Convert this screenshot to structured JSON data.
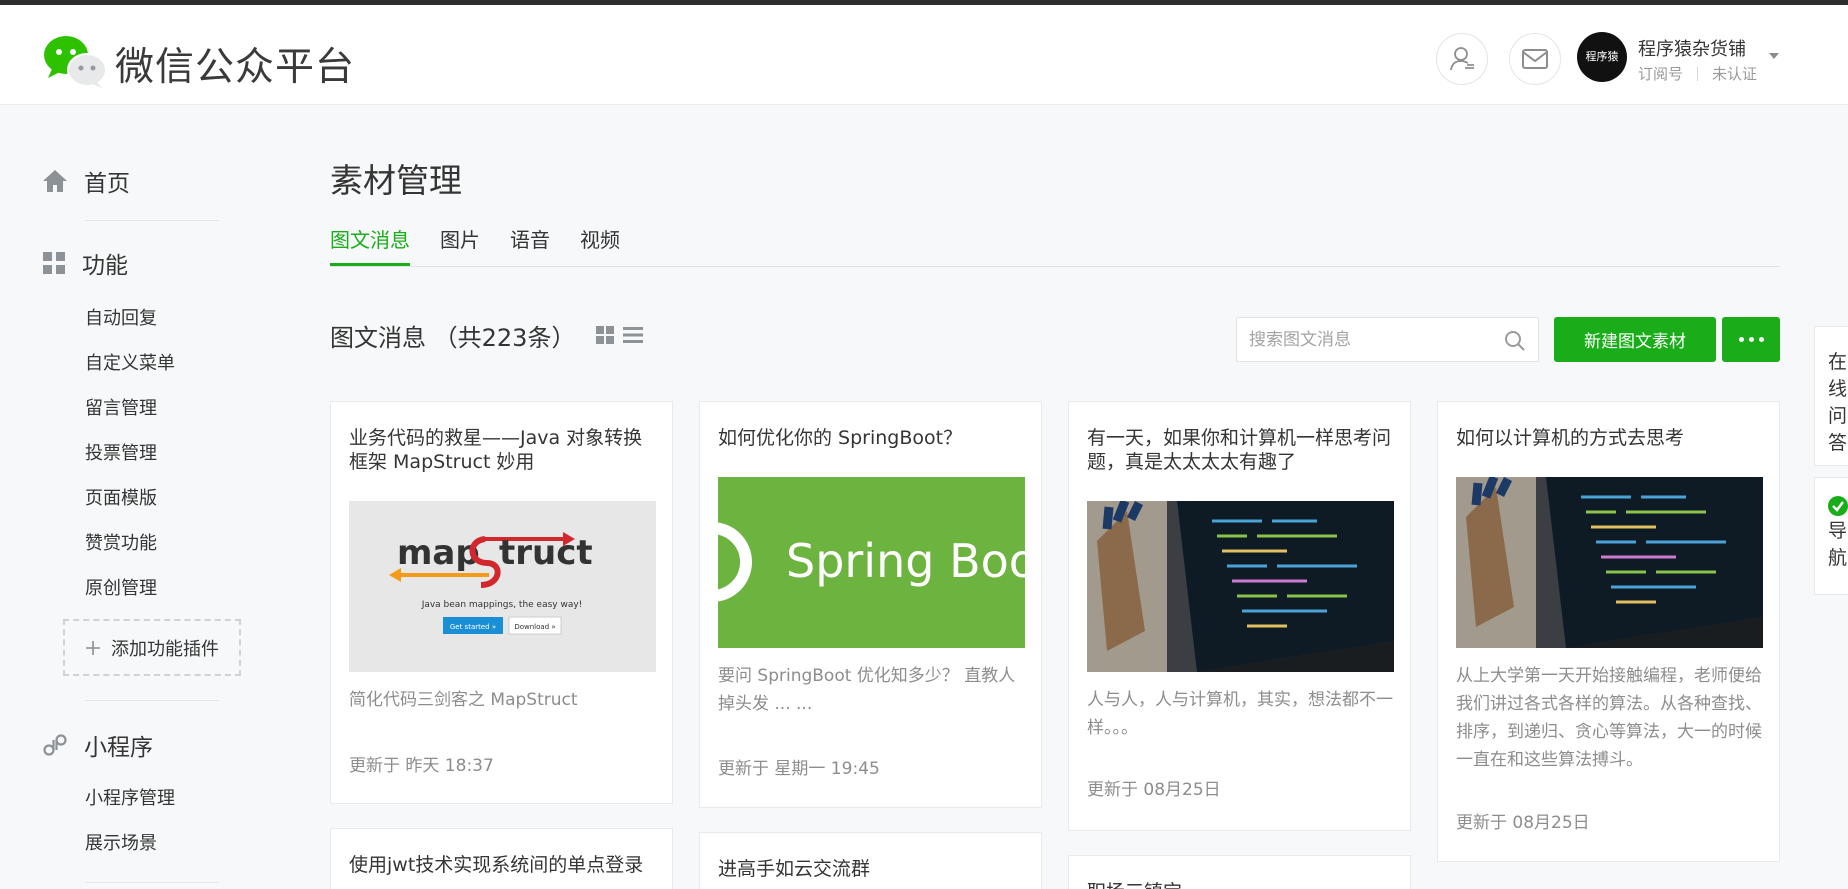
{
  "header": {
    "brand": "微信公众平台",
    "account": {
      "name": "程序猿杂货铺",
      "type": "订阅号",
      "verify": "未认证",
      "avatar_text": "程序猿"
    }
  },
  "sidebar": {
    "home": "首页",
    "features": "功能",
    "feature_items": [
      "自动回复",
      "自定义菜单",
      "留言管理",
      "投票管理",
      "页面模版",
      "赞赏功能",
      "原创管理"
    ],
    "add_plugin": "添加功能插件",
    "miniprogram": "小程序",
    "mini_items": [
      "小程序管理",
      "展示场景"
    ]
  },
  "main": {
    "title": "素材管理",
    "tabs": [
      "图文消息",
      "图片",
      "语音",
      "视频"
    ],
    "active_tab": "图文消息",
    "list_title": "图文消息",
    "list_count": "（共223条）",
    "search_placeholder": "搜索图文消息",
    "new_button": "新建图文素材"
  },
  "cards": [
    {
      "title": "业务代码的救星——Java 对象转换框架 MapStruct 妙用",
      "thumb": "mapstruct",
      "thumb_logo_a": "map",
      "thumb_logo_b": "truct",
      "thumb_tagline": "Java bean mappings, the easy way!",
      "thumb_btn1": "Get started »",
      "thumb_btn2": "Download »",
      "desc": "简化代码三剑客之 MapStruct",
      "time": "更新于 昨天 18:37"
    },
    {
      "title": "如何优化你的 SpringBoot？",
      "thumb": "springboot",
      "thumb_text": "Spring Boo",
      "desc": "要问 SpringBoot 优化知多少？ 直教人掉头发 ... ...",
      "time": "更新于 星期一 19:45"
    },
    {
      "title": "有一天，如果你和计算机一样思考问题，真是太太太太有趣了",
      "thumb": "laptop",
      "desc": "人与人，人与计算机，其实，想法都不一样。。。",
      "time": "更新于 08月25日"
    },
    {
      "title": "如何以计算机的方式去思考",
      "thumb": "laptop",
      "desc": "从上大学第一天开始接触编程，老师便给我们讲过各式各样的算法。从各种查找、排序，到递归、贪心等算法，大一的时候一直在和这些算法搏斗。",
      "time": "更新于 08月25日"
    },
    {
      "title": "使用jwt技术实现系统间的单点登录"
    },
    {
      "title": "进高手如云交流群"
    },
    {
      "title": "职场三镇宝..."
    }
  ],
  "float": {
    "qa": "在线问答",
    "nav": "导航"
  },
  "colors": {
    "accent": "#1aad19",
    "text": "#353535",
    "muted": "#8d8d8d",
    "background": "#f6f8f9"
  }
}
